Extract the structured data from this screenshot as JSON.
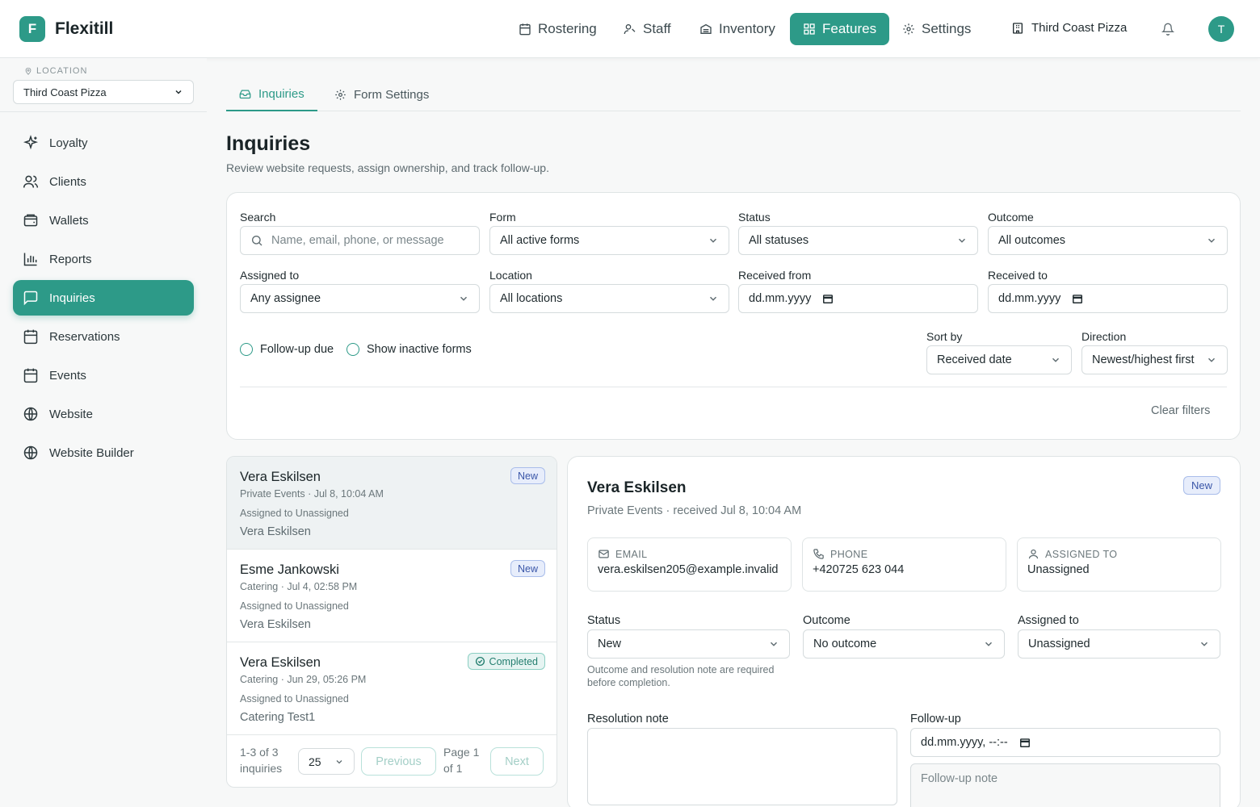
{
  "app": {
    "logo_letter": "F",
    "name": "Flexitill"
  },
  "topnav": {
    "items": [
      {
        "label": "Rostering",
        "icon": "calendar-icon"
      },
      {
        "label": "Staff",
        "icon": "users-icon"
      },
      {
        "label": "Inventory",
        "icon": "archive-icon"
      },
      {
        "label": "Features",
        "icon": "grid-icon",
        "active": true
      },
      {
        "label": "Settings",
        "icon": "gear-icon"
      }
    ],
    "location": "Third Coast Pizza",
    "avatar_letter": "T"
  },
  "sidebar": {
    "location_label": "LOCATION",
    "location_value": "Third Coast Pizza",
    "items": [
      {
        "label": "Loyalty",
        "icon": "sparkles-icon"
      },
      {
        "label": "Clients",
        "icon": "users-icon"
      },
      {
        "label": "Wallets",
        "icon": "wallet-icon"
      },
      {
        "label": "Reports",
        "icon": "bar-chart-icon"
      },
      {
        "label": "Inquiries",
        "icon": "message-square-icon",
        "active": true
      },
      {
        "label": "Reservations",
        "icon": "calendar-icon"
      },
      {
        "label": "Events",
        "icon": "calendar-icon"
      },
      {
        "label": "Website",
        "icon": "globe-icon"
      },
      {
        "label": "Website Builder",
        "icon": "globe-icon"
      }
    ]
  },
  "tabs": [
    {
      "label": "Inquiries",
      "icon": "inbox-icon",
      "active": true
    },
    {
      "label": "Form Settings",
      "icon": "gear-icon"
    }
  ],
  "page": {
    "title": "Inquiries",
    "subtitle": "Review website requests, assign ownership, and track follow-up."
  },
  "filters": {
    "search": {
      "label": "Search",
      "placeholder": "Name, email, phone, or message"
    },
    "form": {
      "label": "Form",
      "value": "All active forms"
    },
    "status": {
      "label": "Status",
      "value": "All statuses"
    },
    "outcome": {
      "label": "Outcome",
      "value": "All outcomes"
    },
    "assigned": {
      "label": "Assigned to",
      "value": "Any assignee"
    },
    "location": {
      "label": "Location",
      "value": "All locations"
    },
    "received_from": {
      "label": "Received from",
      "value": "dd.mm.yyyy"
    },
    "received_to": {
      "label": "Received to",
      "value": "dd.mm.yyyy"
    },
    "followup_due": "Follow-up due",
    "show_inactive": "Show inactive forms",
    "sort_by": {
      "label": "Sort by",
      "value": "Received date"
    },
    "direction": {
      "label": "Direction",
      "value": "Newest/highest first"
    },
    "clear": "Clear filters"
  },
  "inquiries": [
    {
      "name": "Vera Eskilsen",
      "meta": "Private Events · Jul 8, 10:04 AM",
      "assigned": "Assigned to Unassigned",
      "preview": "Vera Eskilsen",
      "badge": "New"
    },
    {
      "name": "Esme Jankowski",
      "meta": "Catering · Jul 4, 02:58 PM",
      "assigned": "Assigned to Unassigned",
      "preview": "Vera Eskilsen",
      "badge": "New"
    },
    {
      "name": "Vera Eskilsen",
      "meta": "Catering · Jun 29, 05:26 PM",
      "assigned": "Assigned to Unassigned",
      "preview": "Catering Test1",
      "badge": "Completed"
    }
  ],
  "pager": {
    "count": "1-3 of 3 inquiries",
    "page_size": "25",
    "previous": "Previous",
    "page": "Page 1 of 1",
    "next": "Next"
  },
  "detail": {
    "name": "Vera Eskilsen",
    "meta": "Private Events · received Jul 8, 10:04 AM",
    "badge": "New",
    "email_label": "EMAIL",
    "email": "vera.eskilsen205@example.invalid",
    "phone_label": "PHONE",
    "phone": "+420725 623 044",
    "assigned_label": "ASSIGNED TO",
    "assigned": "Unassigned",
    "status_label": "Status",
    "status_value": "New",
    "outcome_label": "Outcome",
    "outcome_value": "No outcome",
    "assign_label": "Assigned to",
    "assign_value": "Unassigned",
    "hint": "Outcome and resolution note are required before completion.",
    "resolution_label": "Resolution note",
    "followup_label": "Follow-up",
    "followup_value": "dd.mm.yyyy, --:--",
    "followup_note_placeholder": "Follow-up note"
  },
  "colors": {
    "accent": "#2d9a88",
    "badge_new": "#3a56a8",
    "badge_completed": "#237e6f"
  }
}
